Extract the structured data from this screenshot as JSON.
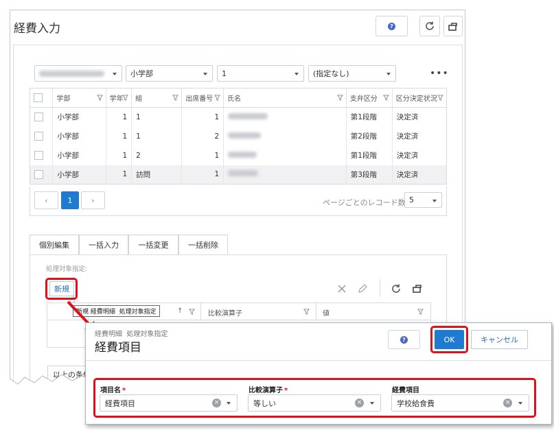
{
  "window": {
    "title": "経費入力"
  },
  "filters": {
    "school": "",
    "level": "小学部",
    "grade": "1",
    "class": "(指定なし)"
  },
  "grid": {
    "headers": [
      "学部",
      "学年",
      "組",
      "出席番号",
      "氏名",
      "支弁区分",
      "区分決定状況"
    ],
    "rows": [
      [
        "小学部",
        "1",
        "1",
        "1",
        "",
        "第1段階",
        "決定済"
      ],
      [
        "小学部",
        "1",
        "1",
        "2",
        "",
        "第2段階",
        "決定済"
      ],
      [
        "小学部",
        "1",
        "2",
        "1",
        "",
        "第1段階",
        "決定済"
      ],
      [
        "小学部",
        "1",
        "訪問",
        "1",
        "",
        "第3段階",
        "決定済"
      ]
    ]
  },
  "pager": {
    "current": "1",
    "per_page_label": "ページごとのレコード数",
    "per_page": "5"
  },
  "tabs": [
    "個別編集",
    "一括入力",
    "一括変更",
    "一括削除"
  ],
  "section": {
    "label": "処理対象指定:",
    "new_button": "新規"
  },
  "subgrid": {
    "headers": [
      "比較演算子",
      "値"
    ]
  },
  "tooltip": "新規 経費明細  処理対象指定",
  "bottom_button": "以上の条件",
  "dialog": {
    "breadcrumb": "経費明細  処理対象指定",
    "title": "経費項目",
    "ok": "OK",
    "cancel": "キャンセル",
    "fields": [
      {
        "label": "項目名",
        "required": "*",
        "value": "経費項目"
      },
      {
        "label": "比較演算子",
        "required": "*",
        "value": "等しい"
      },
      {
        "label": "経費項目",
        "required": "",
        "value": "学校給食費"
      }
    ]
  },
  "colors": {
    "accent": "#1f7ad1",
    "highlight": "#e0101b"
  }
}
